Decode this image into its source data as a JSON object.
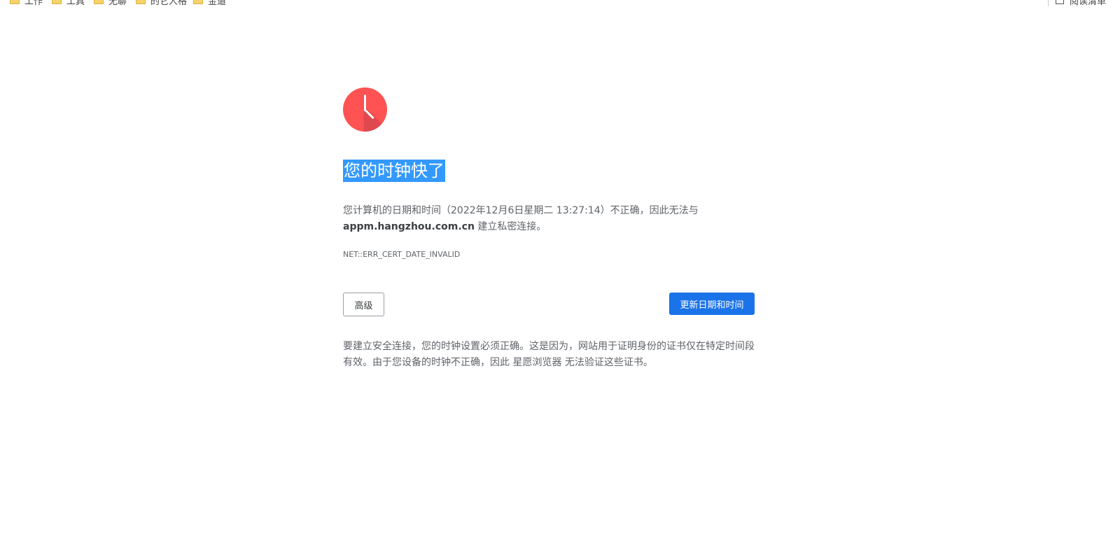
{
  "bookmarks": [
    {
      "label": "工作"
    },
    {
      "label": "工具"
    },
    {
      "label": "无聊"
    },
    {
      "label": "的它人格"
    },
    {
      "label": "金道"
    }
  ],
  "reading_list": {
    "label": "阅读清单"
  },
  "interstitial": {
    "heading": "您的时钟快了",
    "para_prefix": "您计算机的日期和时间（2022年12月6日星期二 13:27:14）不正确，因此无法与",
    "domain": "appm.hangzhou.com.cn",
    "para_suffix": " 建立私密连接。",
    "error_code": "NET::ERR_CERT_DATE_INVALID",
    "advanced_label": "高级",
    "update_label": "更新日期和时间",
    "details": "要建立安全连接，您的时钟设置必须正确。这是因为，网站用于证明身份的证书仅在特定时间段有效。由于您设备的时钟不正确，因此 星愿浏览器 无法验证这些证书。"
  },
  "colors": {
    "clock_red": "#ff5252",
    "clock_shadow": "#c4404a",
    "primary_button": "#1a73e8",
    "selection": "#3399ff"
  },
  "icons": {
    "clock": "clock-icon",
    "folder": "folder-icon",
    "reading_list": "reading-list-icon"
  }
}
